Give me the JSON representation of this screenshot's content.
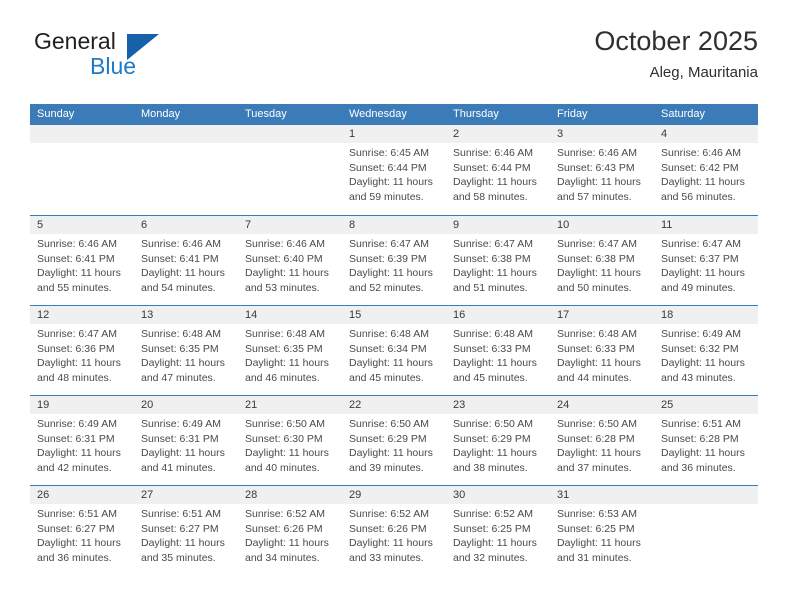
{
  "brand": {
    "word_one": "General",
    "word_two": "Blue",
    "logo_icon": "triangle-logo-icon"
  },
  "header": {
    "title": "October 2025",
    "subtitle": "Aleg, Mauritania"
  },
  "colors": {
    "header_band": "#3b7cb8",
    "row_separator": "#3b7cb8",
    "day_band": "#f0f0f0",
    "brand_blue": "#1f7ac6",
    "brand_dark": "#231f20"
  },
  "calendar": {
    "weekday_headers": [
      "Sunday",
      "Monday",
      "Tuesday",
      "Wednesday",
      "Thursday",
      "Friday",
      "Saturday"
    ],
    "weeks": [
      [
        {
          "day": "",
          "lines": []
        },
        {
          "day": "",
          "lines": []
        },
        {
          "day": "",
          "lines": []
        },
        {
          "day": "1",
          "lines": [
            "Sunrise: 6:45 AM",
            "Sunset: 6:44 PM",
            "Daylight: 11 hours",
            "and 59 minutes."
          ]
        },
        {
          "day": "2",
          "lines": [
            "Sunrise: 6:46 AM",
            "Sunset: 6:44 PM",
            "Daylight: 11 hours",
            "and 58 minutes."
          ]
        },
        {
          "day": "3",
          "lines": [
            "Sunrise: 6:46 AM",
            "Sunset: 6:43 PM",
            "Daylight: 11 hours",
            "and 57 minutes."
          ]
        },
        {
          "day": "4",
          "lines": [
            "Sunrise: 6:46 AM",
            "Sunset: 6:42 PM",
            "Daylight: 11 hours",
            "and 56 minutes."
          ]
        }
      ],
      [
        {
          "day": "5",
          "lines": [
            "Sunrise: 6:46 AM",
            "Sunset: 6:41 PM",
            "Daylight: 11 hours",
            "and 55 minutes."
          ]
        },
        {
          "day": "6",
          "lines": [
            "Sunrise: 6:46 AM",
            "Sunset: 6:41 PM",
            "Daylight: 11 hours",
            "and 54 minutes."
          ]
        },
        {
          "day": "7",
          "lines": [
            "Sunrise: 6:46 AM",
            "Sunset: 6:40 PM",
            "Daylight: 11 hours",
            "and 53 minutes."
          ]
        },
        {
          "day": "8",
          "lines": [
            "Sunrise: 6:47 AM",
            "Sunset: 6:39 PM",
            "Daylight: 11 hours",
            "and 52 minutes."
          ]
        },
        {
          "day": "9",
          "lines": [
            "Sunrise: 6:47 AM",
            "Sunset: 6:38 PM",
            "Daylight: 11 hours",
            "and 51 minutes."
          ]
        },
        {
          "day": "10",
          "lines": [
            "Sunrise: 6:47 AM",
            "Sunset: 6:38 PM",
            "Daylight: 11 hours",
            "and 50 minutes."
          ]
        },
        {
          "day": "11",
          "lines": [
            "Sunrise: 6:47 AM",
            "Sunset: 6:37 PM",
            "Daylight: 11 hours",
            "and 49 minutes."
          ]
        }
      ],
      [
        {
          "day": "12",
          "lines": [
            "Sunrise: 6:47 AM",
            "Sunset: 6:36 PM",
            "Daylight: 11 hours",
            "and 48 minutes."
          ]
        },
        {
          "day": "13",
          "lines": [
            "Sunrise: 6:48 AM",
            "Sunset: 6:35 PM",
            "Daylight: 11 hours",
            "and 47 minutes."
          ]
        },
        {
          "day": "14",
          "lines": [
            "Sunrise: 6:48 AM",
            "Sunset: 6:35 PM",
            "Daylight: 11 hours",
            "and 46 minutes."
          ]
        },
        {
          "day": "15",
          "lines": [
            "Sunrise: 6:48 AM",
            "Sunset: 6:34 PM",
            "Daylight: 11 hours",
            "and 45 minutes."
          ]
        },
        {
          "day": "16",
          "lines": [
            "Sunrise: 6:48 AM",
            "Sunset: 6:33 PM",
            "Daylight: 11 hours",
            "and 45 minutes."
          ]
        },
        {
          "day": "17",
          "lines": [
            "Sunrise: 6:48 AM",
            "Sunset: 6:33 PM",
            "Daylight: 11 hours",
            "and 44 minutes."
          ]
        },
        {
          "day": "18",
          "lines": [
            "Sunrise: 6:49 AM",
            "Sunset: 6:32 PM",
            "Daylight: 11 hours",
            "and 43 minutes."
          ]
        }
      ],
      [
        {
          "day": "19",
          "lines": [
            "Sunrise: 6:49 AM",
            "Sunset: 6:31 PM",
            "Daylight: 11 hours",
            "and 42 minutes."
          ]
        },
        {
          "day": "20",
          "lines": [
            "Sunrise: 6:49 AM",
            "Sunset: 6:31 PM",
            "Daylight: 11 hours",
            "and 41 minutes."
          ]
        },
        {
          "day": "21",
          "lines": [
            "Sunrise: 6:50 AM",
            "Sunset: 6:30 PM",
            "Daylight: 11 hours",
            "and 40 minutes."
          ]
        },
        {
          "day": "22",
          "lines": [
            "Sunrise: 6:50 AM",
            "Sunset: 6:29 PM",
            "Daylight: 11 hours",
            "and 39 minutes."
          ]
        },
        {
          "day": "23",
          "lines": [
            "Sunrise: 6:50 AM",
            "Sunset: 6:29 PM",
            "Daylight: 11 hours",
            "and 38 minutes."
          ]
        },
        {
          "day": "24",
          "lines": [
            "Sunrise: 6:50 AM",
            "Sunset: 6:28 PM",
            "Daylight: 11 hours",
            "and 37 minutes."
          ]
        },
        {
          "day": "25",
          "lines": [
            "Sunrise: 6:51 AM",
            "Sunset: 6:28 PM",
            "Daylight: 11 hours",
            "and 36 minutes."
          ]
        }
      ],
      [
        {
          "day": "26",
          "lines": [
            "Sunrise: 6:51 AM",
            "Sunset: 6:27 PM",
            "Daylight: 11 hours",
            "and 36 minutes."
          ]
        },
        {
          "day": "27",
          "lines": [
            "Sunrise: 6:51 AM",
            "Sunset: 6:27 PM",
            "Daylight: 11 hours",
            "and 35 minutes."
          ]
        },
        {
          "day": "28",
          "lines": [
            "Sunrise: 6:52 AM",
            "Sunset: 6:26 PM",
            "Daylight: 11 hours",
            "and 34 minutes."
          ]
        },
        {
          "day": "29",
          "lines": [
            "Sunrise: 6:52 AM",
            "Sunset: 6:26 PM",
            "Daylight: 11 hours",
            "and 33 minutes."
          ]
        },
        {
          "day": "30",
          "lines": [
            "Sunrise: 6:52 AM",
            "Sunset: 6:25 PM",
            "Daylight: 11 hours",
            "and 32 minutes."
          ]
        },
        {
          "day": "31",
          "lines": [
            "Sunrise: 6:53 AM",
            "Sunset: 6:25 PM",
            "Daylight: 11 hours",
            "and 31 minutes."
          ]
        },
        {
          "day": "",
          "lines": []
        }
      ]
    ]
  }
}
